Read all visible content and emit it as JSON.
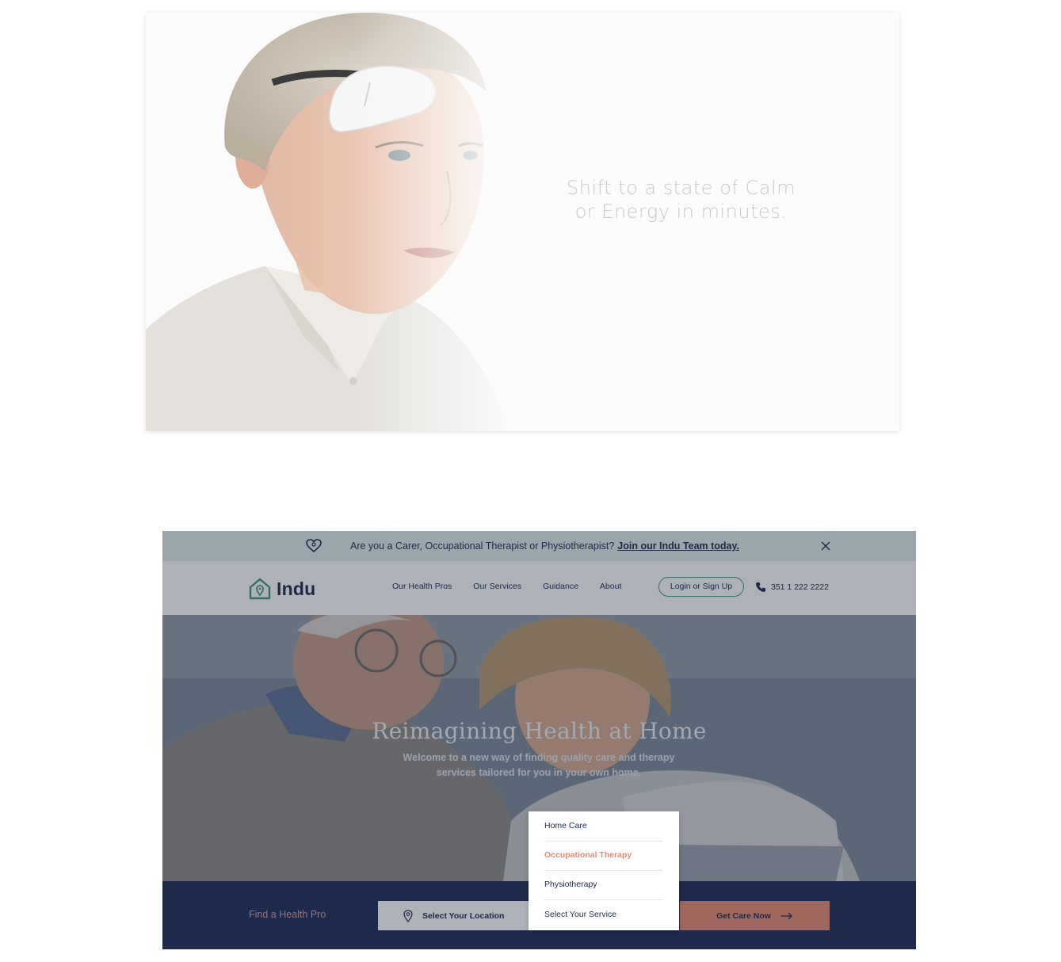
{
  "wearable": {
    "tagline_line1": "Shift to a state of Calm",
    "tagline_line2": "or Energy in minutes."
  },
  "indu": {
    "banner": {
      "icon": "heart-icon",
      "message": "Are you a Carer, Occupational Therapist or Physiotherapist?",
      "link": "Join our Indu Team today.",
      "close_icon": "close-icon"
    },
    "logo": {
      "text": "Indu",
      "icon": "house-pin-icon",
      "color": "#3f9a84"
    },
    "nav": [
      {
        "label": "Our Health Pros"
      },
      {
        "label": "Our Services"
      },
      {
        "label": "Guidance"
      },
      {
        "label": "About"
      }
    ],
    "login_label": "Login or Sign Up",
    "phone": "351 1 222 2222",
    "hero": {
      "title": "Reimagining Health at Home",
      "subtitle": "Welcome to a new way of finding quality care and therapy services tailored for you in your own home."
    },
    "search": {
      "label": "Find a Health Pro",
      "location_placeholder": "Select Your Location",
      "service_placeholder": "Select Your Service",
      "cta": "Get Care Now"
    },
    "dropdown": {
      "options": [
        {
          "label": "Home Care"
        },
        {
          "label": "Occupational Therapy",
          "selected": true
        },
        {
          "label": "Physiotherapy"
        }
      ]
    },
    "colors": {
      "navy": "#1e2d55",
      "accent": "#e98b72",
      "teal": "#3f9a84"
    }
  }
}
